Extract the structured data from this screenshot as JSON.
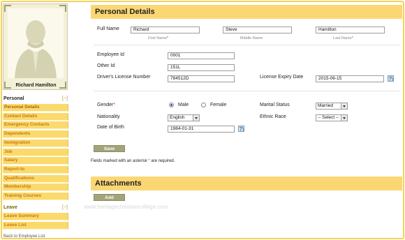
{
  "profile": {
    "name": "Richard Hamilton"
  },
  "sidebar": {
    "personal_header": "Personal",
    "personal_toggle": "[−]",
    "personal_items": [
      "Personal Details",
      "Contact Details",
      "Emergency Contacts",
      "Dependents",
      "Immigration",
      "Job",
      "Salary",
      "Report-to",
      "Qualifications",
      "Membership",
      "Training Courses"
    ],
    "leave_header": "Leave",
    "leave_toggle": "[−]",
    "leave_items": [
      "Leave Summary",
      "Leave List"
    ],
    "back_link": "Back to Employee List"
  },
  "personal_details": {
    "title": "Personal Details",
    "full_name_label": "Full Name",
    "first_name": "Richard",
    "middle_name": "Steve",
    "last_name": "Hamilton",
    "first_name_hint": "First Name",
    "middle_name_hint": "Middle Name",
    "last_name_hint": "Last Name",
    "required_marker": "*",
    "employee_id_label": "Employee Id",
    "employee_id": "0001",
    "other_id_label": "Other Id",
    "other_id": "151L",
    "license_label": "Driver's License Number",
    "license": "784512D",
    "license_expiry_label": "License Expiry Date",
    "license_expiry": "2015-06-15",
    "gender_label": "Gender",
    "gender_male": "Male",
    "gender_female": "Female",
    "marital_label": "Marital Status",
    "marital_value": "Married",
    "nationality_label": "Nationality",
    "nationality_value": "English",
    "ethnic_label": "Ethnic Race",
    "ethnic_value": "-- Select --",
    "dob_label": "Date of Birth",
    "dob": "1984-01-31",
    "save_button": "Save",
    "required_note_pre": "Fields marked with an asterisk ",
    "required_note_post": " are required."
  },
  "attachments": {
    "title": "Attachments",
    "add_button": "Add"
  },
  "watermark": "www.heritagechristiancollege.com",
  "colors": {
    "accent": "#fbd774",
    "menu_item": "#fbda6d",
    "button": "#a4a47a"
  }
}
